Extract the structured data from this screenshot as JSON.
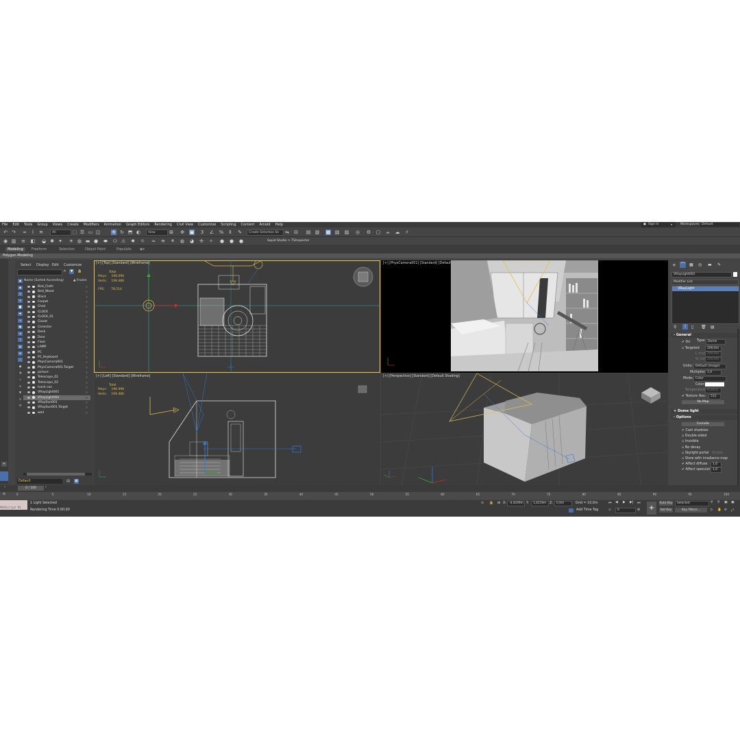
{
  "menu": [
    "File",
    "Edit",
    "Tools",
    "Group",
    "Views",
    "Create",
    "Modifiers",
    "Animation",
    "Graph Editors",
    "Rendering",
    "Civil View",
    "Customize",
    "Scripting",
    "Content",
    "Arnold",
    "Help"
  ],
  "account": {
    "sign_in": "Sign In",
    "workspaces_label": "Workspaces:",
    "workspace_value": "Default"
  },
  "toolbar": {
    "filter_value": "All",
    "view_value": "View",
    "selection_set": "Create Selection Se",
    "project_path": "Squid Studio > TSInspector"
  },
  "ribbon": {
    "tabs": [
      "Modeling",
      "Freeform",
      "Selection",
      "Object Paint",
      "Populate"
    ],
    "subtitle": "Polygon Modeling"
  },
  "scene_explorer": {
    "tabs": [
      "Select",
      "Display",
      "Edit",
      "Customize"
    ],
    "column_header": "Name (Sorted Ascending)",
    "frozen_header": "▲ Frozen",
    "objects": [
      "Bed_Cloth",
      "Bed_Wood",
      "Black",
      "Carpet",
      "Chair",
      "CLOCK",
      "CLOCK_01",
      "Closet",
      "Conector",
      "Desk",
      "Door",
      "Floor",
      "LAMP",
      "PC",
      "PC_Keyboard",
      "PhysCamera001",
      "PhysCamera001.Target",
      "picture",
      "Telescope_01",
      "Telescope_02",
      "trash can",
      "VRayLight001",
      "VRayLight002",
      "VRaySun001",
      "VRaySun001.Target",
      "wall"
    ],
    "selected_object": "VRayLight002",
    "layer_value": "Default"
  },
  "viewports": {
    "top": {
      "label": "[+] [Top] [Standard] [Wireframe]",
      "total": "Total",
      "polys_label": "Polys:",
      "polys": "196.096",
      "verts_label": "Verts:",
      "verts": "199.486",
      "fps_label": "FPS:",
      "fps": "78,514"
    },
    "camera": {
      "label": "[+] [PhysCamera001] [Standard] [Default Shading]"
    },
    "left": {
      "label": "[+] [Left] [Standard] [Wireframe]",
      "total": "Total",
      "polys_label": "Polys:",
      "polys": "196.096",
      "verts_label": "Verts:",
      "verts": "199.486"
    },
    "perspective": {
      "label": "[+] [Perspective] [Standard] [Default Shading]"
    }
  },
  "command_panel": {
    "object_name": "VRayLight002",
    "modifier_list": "Modifier List",
    "stack_item": "VRayLight",
    "general": "General",
    "on_label": "On",
    "type_label": "Type:",
    "type_value": "Dome",
    "targeted_label": "Targeted",
    "targeted_value": "200,0m",
    "length_label": "L ength",
    "length_value": "200,0m",
    "width_label": "W idth",
    "width_value": "200,0m",
    "units_label": "Units:",
    "units_value": "Default (image)",
    "multiplier_label": "Multiplier:",
    "multiplier_value": "1,0",
    "mode_label": "Mode:",
    "mode_value": "Color",
    "color_label": "Color:",
    "temperature_label": "Temperature:",
    "temperature_value": "6500,0",
    "texture_label": "Texture",
    "res_label": "Res:",
    "res_value": "512",
    "no_map": "No Map",
    "dome_light": "Dome light",
    "options": "Options",
    "exclude": "Exclude",
    "option_items": [
      "Cast shadows",
      "Double-sided",
      "Invisible",
      "No decay",
      "Skylight portal",
      "Store with irradiance map",
      "Affect diffuse",
      "Affect specular"
    ],
    "simple_label": "Simple",
    "affect_diffuse_value": "1,0",
    "affect_specular_value": "1,0",
    "white_color": "#ffffff"
  },
  "timeline": {
    "frame_counter": "0 / 100",
    "ticks": [
      "0",
      "5",
      "10",
      "15",
      "20",
      "25",
      "30",
      "35",
      "40",
      "45",
      "50",
      "55",
      "60",
      "65",
      "70",
      "75",
      "80",
      "85",
      "90",
      "95",
      "100"
    ]
  },
  "status": {
    "maxscript": "MAXScript Mi",
    "selection": "1 Light Selected",
    "render_time": "Rendering Time  0:00:00",
    "x_label": "X:",
    "x_value": "-4,4249m",
    "y_label": "Y:",
    "y_value": "1,4219m",
    "z_label": "Z:",
    "z_value": "0,0m",
    "grid": "Grid = 10,0m",
    "add_time_tag": "Add Time Tag",
    "frame_value": "0",
    "auto_key": "Auto Key",
    "selected": "Selected",
    "set_key": "Set Key",
    "key_filters": "Key Filters..."
  },
  "colors": {
    "accent": "#5b7fb6",
    "active_viewport": "#e8c64a",
    "light_gizmo": "#e2c04e",
    "grid_cyan": "#2fa3a3"
  }
}
